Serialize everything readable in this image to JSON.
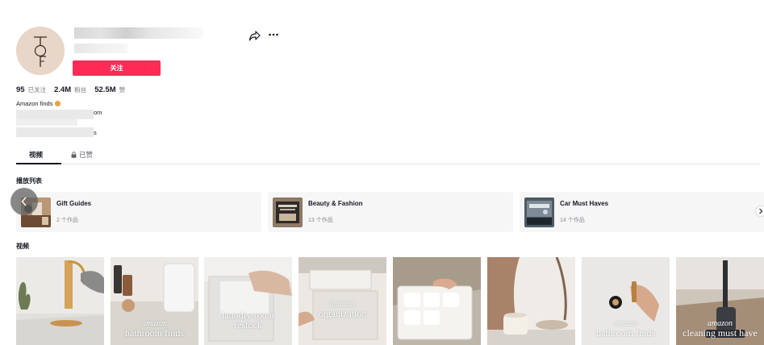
{
  "profile": {
    "avatar_monogram": "TOF",
    "follow_label": "关注"
  },
  "stats": [
    {
      "value": "95",
      "label": "已关注"
    },
    {
      "value": "2.4M",
      "label": "粉丝"
    },
    {
      "value": "52.5M",
      "label": "赞"
    }
  ],
  "bio": {
    "line1": "Amazon finds",
    "fragment2": "om",
    "fragment3": "s"
  },
  "tabs": [
    {
      "label": "视频",
      "active": true
    },
    {
      "label": "已赞",
      "locked": true
    }
  ],
  "playlists": {
    "title": "播放列表",
    "items": [
      {
        "name": "Gift Guides",
        "count": "2 个作品"
      },
      {
        "name": "Beauty & Fashion",
        "count": "13 个作品"
      },
      {
        "name": "Car Must Haves",
        "count": "14 个作品"
      }
    ]
  },
  "videos": {
    "title": "视频",
    "items": [
      {
        "overlay_small": "",
        "overlay_big": ""
      },
      {
        "overlay_small": "amazon",
        "overlay_big": "bathroom finds"
      },
      {
        "overlay_small": "laundry room",
        "overlay_big": "restock"
      },
      {
        "overlay_small": "amazon",
        "overlay_big": "organization"
      },
      {
        "overlay_small": "",
        "overlay_big": ""
      },
      {
        "overlay_small": "",
        "overlay_big": ""
      },
      {
        "overlay_small": "amazon",
        "overlay_big": "bathroom finds"
      },
      {
        "overlay_small": "amazon",
        "overlay_big": "cleaning must have"
      }
    ]
  },
  "colors": {
    "accent": "#fe2c55",
    "text_primary": "#161823",
    "text_secondary": "#73757a",
    "card_bg": "#f6f6f6"
  },
  "icons": [
    "share-icon",
    "more-icon",
    "lock-icon",
    "chevron-left-icon",
    "chevron-right-icon"
  ]
}
